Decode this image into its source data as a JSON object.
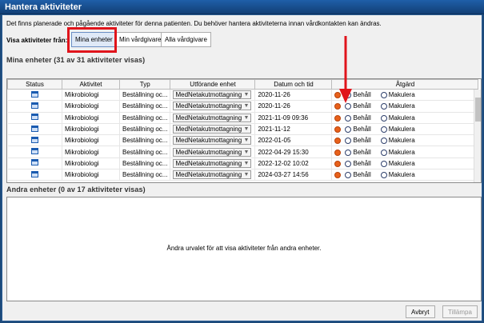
{
  "window": {
    "title": "Hantera aktiviteter"
  },
  "info_text": "Det finns planerade och pågående aktiviteter för denna patienten. Du behöver hantera aktiviteterna innan vårdkontakten kan ändras.",
  "filter": {
    "label": "Visa aktiviteter från:",
    "options": [
      "Mina enheter",
      "Min vårdgivare",
      "Alla vårdgivare"
    ]
  },
  "section_mine": {
    "title": "Mina enheter (31 av 31 aktiviteter visas)"
  },
  "table": {
    "columns": [
      "Status",
      "Aktivitet",
      "Typ",
      "Utförande enhet",
      "Datum och tid",
      "Åtgärd"
    ],
    "rows": [
      {
        "aktivitet": "Mikrobiologi",
        "typ": "Beställning oc...",
        "enhet": "MedNetakutmottagning",
        "datum": "2020-11-26"
      },
      {
        "aktivitet": "Mikrobiologi",
        "typ": "Beställning oc...",
        "enhet": "MedNetakutmottagning",
        "datum": "2020-11-26"
      },
      {
        "aktivitet": "Mikrobiologi",
        "typ": "Beställning oc...",
        "enhet": "MedNetakutmottagning",
        "datum": "2021-11-09 09:36"
      },
      {
        "aktivitet": "Mikrobiologi",
        "typ": "Beställning oc...",
        "enhet": "MedNetakutmottagning",
        "datum": "2021-11-12"
      },
      {
        "aktivitet": "Mikrobiologi",
        "typ": "Beställning oc...",
        "enhet": "MedNetakutmottagning",
        "datum": "2022-01-05"
      },
      {
        "aktivitet": "Mikrobiologi",
        "typ": "Beställning oc...",
        "enhet": "MedNetakutmottagning",
        "datum": "2022-04-29 15:30"
      },
      {
        "aktivitet": "Mikrobiologi",
        "typ": "Beställning oc...",
        "enhet": "MedNetakutmottagning",
        "datum": "2022-12-02 10:02"
      },
      {
        "aktivitet": "Mikrobiologi",
        "typ": "Beställning oc...",
        "enhet": "MedNetakutmottagning",
        "datum": "2024-03-27 14:56"
      }
    ],
    "action_keep": "Behåll",
    "action_cancel": "Makulera"
  },
  "section_other": {
    "title": "Andra enheter (0 av 17 aktiviteter visas)",
    "empty_message": "Ändra urvalet för att visa aktiviteter från andra enheter."
  },
  "buttons": {
    "cancel": "Avbryt",
    "apply": "Tillämpa"
  },
  "colors": {
    "highlight": "#e0141b",
    "title_bar": "#1f5fa8",
    "status_dot": "#e8611b"
  },
  "icons": {
    "status": "calendar-icon",
    "annotation": "red-arrow-icon"
  }
}
